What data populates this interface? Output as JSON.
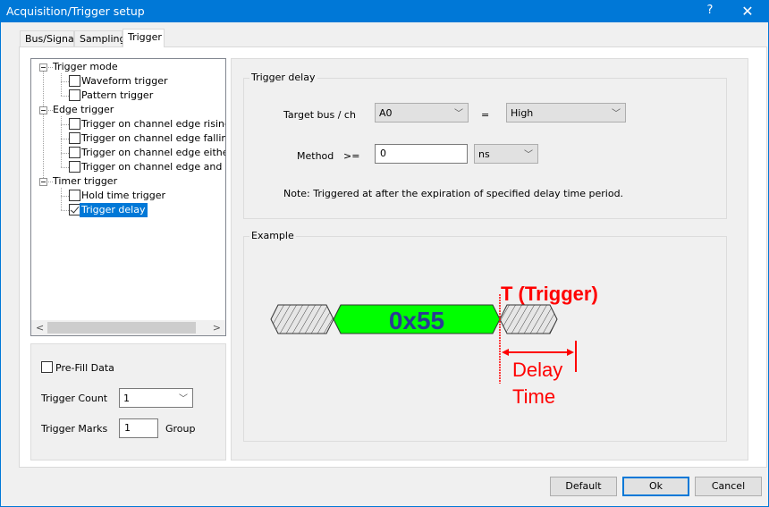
{
  "window": {
    "title": "Acquisition/Trigger setup",
    "help_label": "?",
    "close_label": "✕"
  },
  "tabs": [
    {
      "label": "Bus/Signal"
    },
    {
      "label": "Sampling"
    },
    {
      "label": "Trigger",
      "active": true
    }
  ],
  "tree": {
    "groups": [
      {
        "label": "Trigger mode",
        "items": [
          {
            "label": "Waveform trigger",
            "checked": false
          },
          {
            "label": "Pattern trigger",
            "checked": false
          }
        ]
      },
      {
        "label": "Edge trigger",
        "items": [
          {
            "label": "Trigger on channel edge rising",
            "checked": false
          },
          {
            "label": "Trigger on channel edge falling",
            "checked": false
          },
          {
            "label": "Trigger on channel edge either",
            "checked": false
          },
          {
            "label": "Trigger on channel edge and patt",
            "checked": false
          }
        ]
      },
      {
        "label": "Timer trigger",
        "items": [
          {
            "label": "Hold time trigger",
            "checked": false
          },
          {
            "label": "Trigger delay",
            "checked": true,
            "selected": true
          }
        ]
      }
    ],
    "scroll_left": "<",
    "scroll_right": ">"
  },
  "left_options": {
    "prefill_label": "Pre-Fill Data",
    "prefill_checked": false,
    "trigger_count_label": "Trigger Count",
    "trigger_count_value": "1",
    "trigger_marks_label": "Trigger Marks",
    "trigger_marks_value": "1",
    "group_label": "Group"
  },
  "trigger_delay": {
    "legend": "Trigger delay",
    "target_label": "Target bus / ch",
    "target_value": "A0",
    "equals": "=",
    "level_value": "High",
    "method_label": "Method",
    "operator": ">=",
    "delay_value": "0",
    "unit_value": "ns",
    "note": "Note: Triggered at after the expiration of specified delay time period."
  },
  "example": {
    "legend": "Example",
    "data_label": "0x55",
    "trigger_label": "T (Trigger)",
    "delay_label_1": "Delay",
    "delay_label_2": "Time",
    "colors": {
      "data_fill": "#00ff00",
      "data_text": "#2b3a96",
      "annotation": "#ff0000"
    }
  },
  "buttons": {
    "default": "Default",
    "ok": "Ok",
    "cancel": "Cancel"
  },
  "chevron": "﹀"
}
